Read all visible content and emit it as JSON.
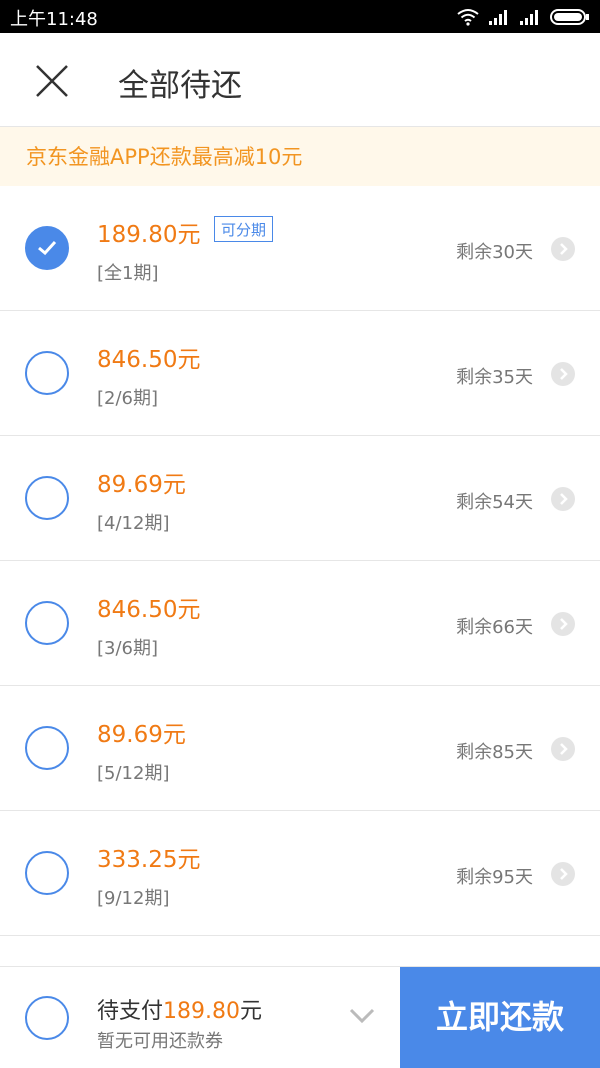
{
  "status_bar": {
    "time": "上午11:48"
  },
  "header": {
    "title": "全部待还"
  },
  "promo": {
    "text": "京东金融APP还款最高减10元"
  },
  "bills": [
    {
      "amount": "189.80元",
      "badge": "可分期",
      "period": "[全1期]",
      "remaining": "剩余30天",
      "checked": true
    },
    {
      "amount": "846.50元",
      "badge": "",
      "period": "[2/6期]",
      "remaining": "剩余35天",
      "checked": false
    },
    {
      "amount": "89.69元",
      "badge": "",
      "period": "[4/12期]",
      "remaining": "剩余54天",
      "checked": false
    },
    {
      "amount": "846.50元",
      "badge": "",
      "period": "[3/6期]",
      "remaining": "剩余66天",
      "checked": false
    },
    {
      "amount": "89.69元",
      "badge": "",
      "period": "[5/12期]",
      "remaining": "剩余85天",
      "checked": false
    },
    {
      "amount": "333.25元",
      "badge": "",
      "period": "[9/12期]",
      "remaining": "剩余95天",
      "checked": false
    }
  ],
  "footer": {
    "pending_label": "待支付",
    "pending_amount": "189.80",
    "pending_unit": "元",
    "coupon_text": "暂无可用还款券",
    "pay_label": "立即还款"
  },
  "colors": {
    "accent": "#4a89e8",
    "amount": "#f07a14",
    "promo_text": "#f29521",
    "promo_bg": "#fff8ea"
  }
}
